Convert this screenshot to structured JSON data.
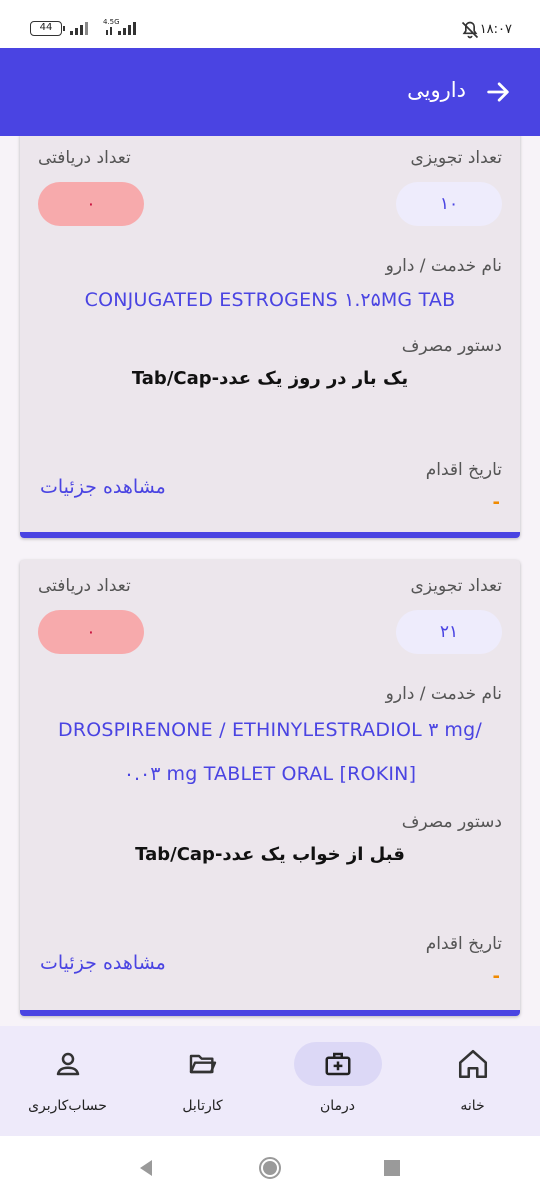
{
  "status_bar": {
    "time": "۱۸:۰۷",
    "battery": "44",
    "network": "4.5G"
  },
  "app_bar": {
    "title": "دارویی"
  },
  "labels": {
    "prescribed_count": "تعداد تجویزی",
    "received_count": "تعداد دریافتی",
    "service_name": "نام خدمت / دارو",
    "usage_instruction": "دستور مصرف",
    "action_date": "تاریخ اقدام",
    "view_details": "مشاهده جزئیات"
  },
  "cards": [
    {
      "prescribed": "۱۰",
      "received": "۰",
      "drug_name_lines": [
        "CONJUGATED ESTROGENS ۱.۲۵MG TAB"
      ],
      "usage": "یک بار در روز یک عدد-Tab/Cap",
      "action_date": "-"
    },
    {
      "prescribed": "۲۱",
      "received": "۰",
      "drug_name_lines": [
        "DROSPIRENONE / ETHINYLESTRADIOL ۳ mg/",
        "۰.۰۳ mg TABLET ORAL [ROKIN]"
      ],
      "usage": "قبل از خواب یک عدد-Tab/Cap",
      "action_date": "-"
    }
  ],
  "bottom_nav": {
    "items": [
      {
        "label": "خانه",
        "icon": "home-icon",
        "active": false
      },
      {
        "label": "درمان",
        "icon": "medical-kit-icon",
        "active": true
      },
      {
        "label": "کارتابل",
        "icon": "folder-icon",
        "active": false
      },
      {
        "label": "حساب‌کاربری",
        "icon": "user-icon",
        "active": false
      }
    ]
  },
  "colors": {
    "primary": "#4a44e2",
    "received_pill": "#f7aaac",
    "prescribed_pill": "#eeecfc",
    "date_dash": "#f08a00"
  }
}
